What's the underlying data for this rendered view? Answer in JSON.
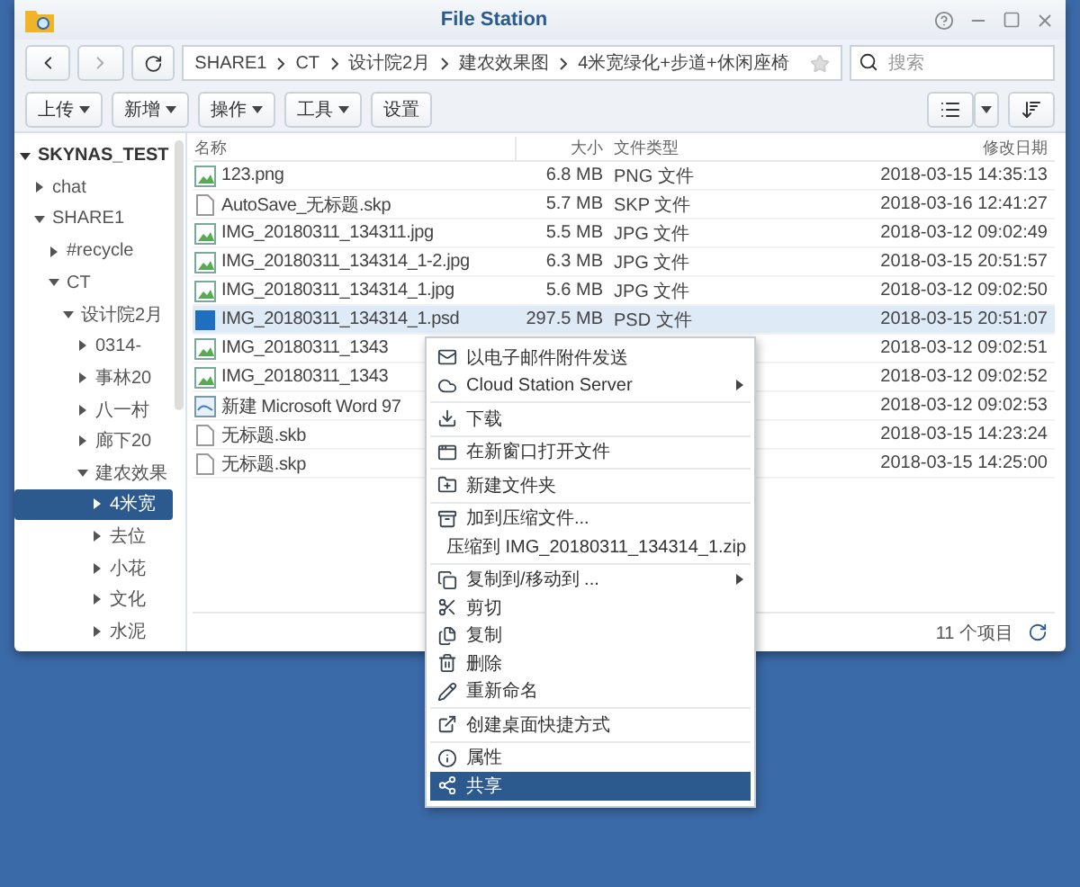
{
  "window": {
    "title": "File Station"
  },
  "path": [
    "SHARE1",
    "CT",
    "设计院2月",
    "建农效果图",
    "4米宽绿化+步道+休闲座椅"
  ],
  "search": {
    "placeholder": "搜索"
  },
  "toolbar": [
    {
      "label": "上传",
      "dropdown": true
    },
    {
      "label": "新增",
      "dropdown": true
    },
    {
      "label": "操作",
      "dropdown": true
    },
    {
      "label": "工具",
      "dropdown": true
    },
    {
      "label": "设置",
      "dropdown": false
    }
  ],
  "tree": [
    {
      "label": "SKYNAS_TEST",
      "expanded": true,
      "selected": false,
      "children": [
        {
          "label": "chat",
          "expanded": false,
          "selected": false
        },
        {
          "label": "SHARE1",
          "expanded": true,
          "selected": false,
          "children": [
            {
              "label": "#recycle",
              "expanded": false,
              "selected": false
            },
            {
              "label": "CT",
              "expanded": true,
              "selected": false,
              "children": [
                {
                  "label": "设计院2月",
                  "expanded": true,
                  "selected": false,
                  "children": [
                    {
                      "label": "0314-",
                      "expanded": false,
                      "selected": false
                    },
                    {
                      "label": "事林20",
                      "expanded": false,
                      "selected": false
                    },
                    {
                      "label": "八一村",
                      "expanded": false,
                      "selected": false
                    },
                    {
                      "label": "廊下20",
                      "expanded": false,
                      "selected": false
                    },
                    {
                      "label": "建农效果",
                      "expanded": true,
                      "selected": false,
                      "children": [
                        {
                          "label": "4米宽",
                          "expanded": false,
                          "selected": true
                        },
                        {
                          "label": "去位",
                          "expanded": false,
                          "selected": false
                        },
                        {
                          "label": "小花",
                          "expanded": false,
                          "selected": false
                        },
                        {
                          "label": "文化",
                          "expanded": false,
                          "selected": false
                        },
                        {
                          "label": "水泥",
                          "expanded": false,
                          "selected": false
                        }
                      ]
                    }
                  ]
                }
              ]
            }
          ]
        }
      ]
    }
  ],
  "table": {
    "columns": [
      "名称",
      "大小",
      "文件类型",
      "修改日期"
    ],
    "rows": [
      {
        "kind": "image",
        "name": "123.png",
        "size": "6.8 MB",
        "type": "PNG 文件",
        "date": "2018-03-15 14:35:13",
        "selected": false
      },
      {
        "kind": "file",
        "name": "AutoSave_无标题.skp",
        "size": "5.7 MB",
        "type": "SKP 文件",
        "date": "2018-03-16 12:41:27",
        "selected": false
      },
      {
        "kind": "image",
        "name": "IMG_20180311_134311.jpg",
        "size": "5.5 MB",
        "type": "JPG 文件",
        "date": "2018-03-12 09:02:49",
        "selected": false
      },
      {
        "kind": "image",
        "name": "IMG_20180311_134314_1-2.jpg",
        "size": "6.3 MB",
        "type": "JPG 文件",
        "date": "2018-03-15 20:51:57",
        "selected": false
      },
      {
        "kind": "image",
        "name": "IMG_20180311_134314_1.jpg",
        "size": "5.6 MB",
        "type": "JPG 文件",
        "date": "2018-03-12 09:02:50",
        "selected": false
      },
      {
        "kind": "psd",
        "name": "IMG_20180311_134314_1.psd",
        "size": "297.5 MB",
        "type": "PSD 文件",
        "date": "2018-03-15 20:51:07",
        "selected": true
      },
      {
        "kind": "image",
        "name": "IMG_20180311_1343",
        "date": "2018-03-12 09:02:51",
        "selected": false
      },
      {
        "kind": "image",
        "name": "IMG_20180311_1343",
        "date": "2018-03-12 09:02:52",
        "selected": false
      },
      {
        "kind": "doc",
        "name": "新建 Microsoft Word 97",
        "date": "2018-03-12 09:02:53",
        "selected": false
      },
      {
        "kind": "file",
        "name": "无标题.skb",
        "date": "2018-03-15 14:23:24",
        "selected": false
      },
      {
        "kind": "file",
        "name": "无标题.skp",
        "date": "2018-03-15 14:25:00",
        "selected": false
      }
    ]
  },
  "status_bar": {
    "count": "11 个项目"
  },
  "context_menu": [
    [
      {
        "label": "以电子邮件附件发送",
        "submenu": false,
        "selected": false
      },
      {
        "label": "Cloud Station Server",
        "submenu": true,
        "selected": false
      }
    ],
    [
      {
        "label": "下载",
        "submenu": false,
        "selected": false
      }
    ],
    [
      {
        "label": "在新窗口打开文件",
        "submenu": false,
        "selected": false
      }
    ],
    [
      {
        "label": "新建文件夹",
        "submenu": false,
        "selected": false
      }
    ],
    [
      {
        "label": "加到压缩文件...",
        "submenu": false,
        "selected": false
      },
      {
        "label": "压缩到 IMG_20180311_134314_1.zip",
        "submenu": false,
        "selected": false
      }
    ],
    [
      {
        "label": "复制到/移动到 ...",
        "submenu": true,
        "selected": false
      },
      {
        "label": "剪切",
        "submenu": false,
        "selected": false
      },
      {
        "label": "复制",
        "submenu": false,
        "selected": false
      },
      {
        "label": "删除",
        "submenu": false,
        "selected": false
      },
      {
        "label": "重新命名",
        "submenu": false,
        "selected": false
      }
    ],
    [
      {
        "label": "创建桌面快捷方式",
        "submenu": false,
        "selected": false
      }
    ],
    [
      {
        "label": "属性",
        "submenu": false,
        "selected": false
      },
      {
        "label": "共享",
        "submenu": false,
        "selected": true
      }
    ]
  ]
}
